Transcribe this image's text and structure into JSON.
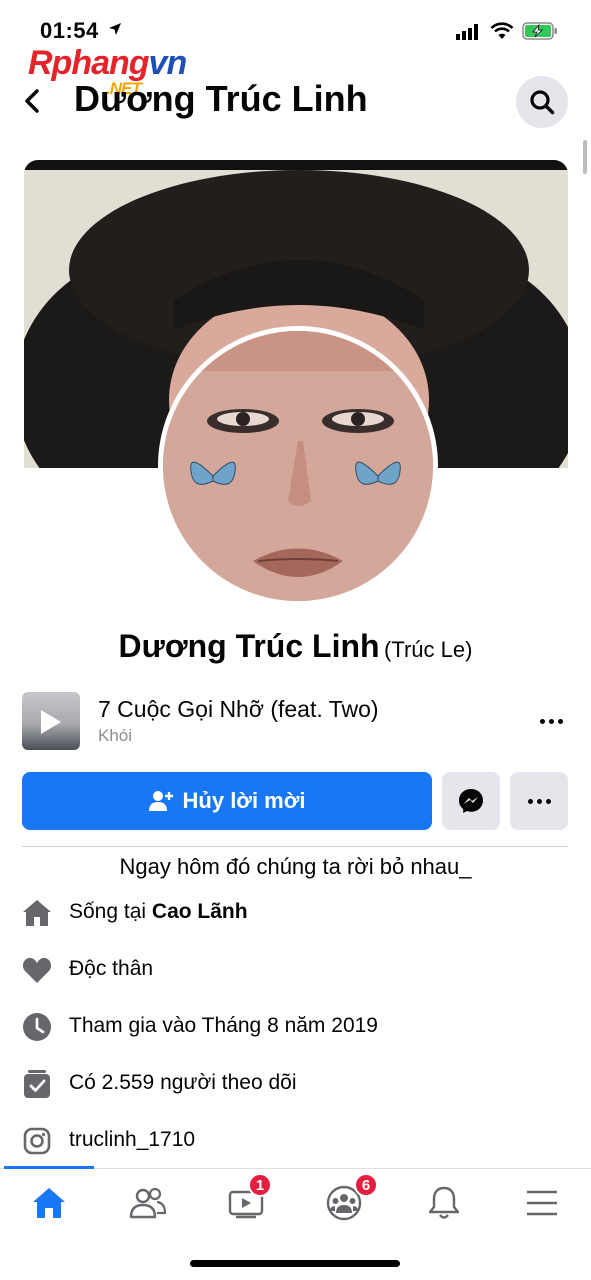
{
  "status_bar": {
    "time": "01:54"
  },
  "watermark": {
    "part1": "Rphang",
    "part2": "vn",
    "suffix": ".NET"
  },
  "header": {
    "title": "Dương Trúc Linh"
  },
  "profile": {
    "name": "Dương Trúc Linh",
    "alternate_name": "(Trúc Le)"
  },
  "music": {
    "title": "7 Cuộc Gọi Nhỡ (feat. Two)",
    "artist": "Khói"
  },
  "actions": {
    "primary_label": "Hủy lời mời"
  },
  "bio": "Ngay hôm đó chúng ta rời bỏ nhau_",
  "details": {
    "lives_prefix": "Sống tại ",
    "lives_place": "Cao Lãnh",
    "relationship": "Độc thân",
    "joined": "Tham gia vào Tháng 8 năm 2019",
    "followers": "Có 2.559 người theo dõi",
    "instagram": "truclinh_1710"
  },
  "tab_bar": {
    "video_badge": "1",
    "groups_badge": "6"
  },
  "colors": {
    "accent": "#1877f2",
    "badge": "#e41e3f",
    "secondary_button": "#e4e6eb"
  }
}
